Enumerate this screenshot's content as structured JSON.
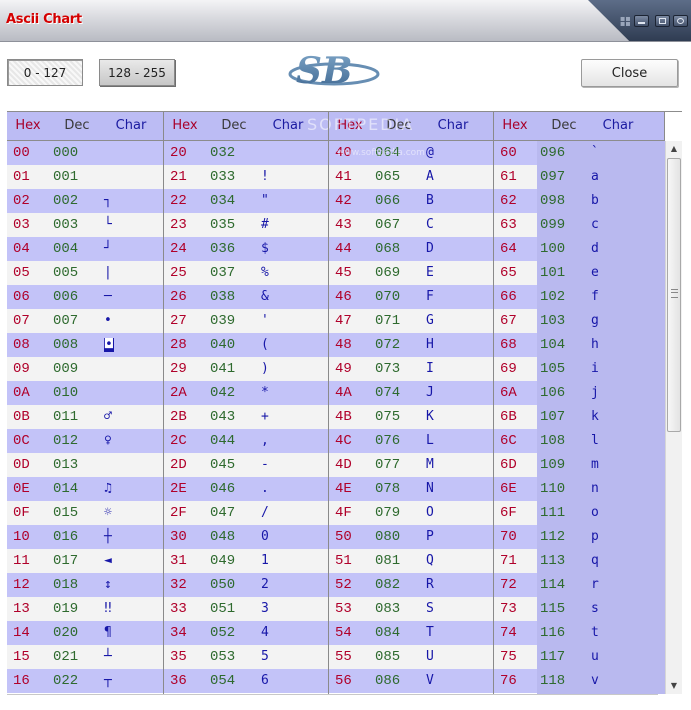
{
  "window": {
    "title": "Ascii Chart"
  },
  "toolbar": {
    "range_low_label": "0 - 127",
    "range_high_label": "128 - 255",
    "close_label": "Close",
    "logo_text": "SB"
  },
  "watermark": {
    "main": "SOFTPEDIA",
    "sub": "www.softpedia.com"
  },
  "table": {
    "groups": [
      {
        "hex": "Hex",
        "dec": "Dec",
        "char": "Char"
      },
      {
        "hex": "Hex",
        "dec": "Dec",
        "char": "Char"
      },
      {
        "hex": "Hex",
        "dec": "Dec",
        "char": "Char"
      },
      {
        "hex": "Hex",
        "dec": "Dec",
        "char": "Char"
      }
    ],
    "rows": [
      [
        [
          "00",
          "000",
          ""
        ],
        [
          "20",
          "032",
          ""
        ],
        [
          "40",
          "064",
          "@"
        ],
        [
          "60",
          "096",
          "`"
        ]
      ],
      [
        [
          "01",
          "001",
          ""
        ],
        [
          "21",
          "033",
          "!"
        ],
        [
          "41",
          "065",
          "A"
        ],
        [
          "61",
          "097",
          "a"
        ]
      ],
      [
        [
          "02",
          "002",
          "┐"
        ],
        [
          "22",
          "034",
          "\""
        ],
        [
          "42",
          "066",
          "B"
        ],
        [
          "62",
          "098",
          "b"
        ]
      ],
      [
        [
          "03",
          "003",
          "└"
        ],
        [
          "23",
          "035",
          "#"
        ],
        [
          "43",
          "067",
          "C"
        ],
        [
          "63",
          "099",
          "c"
        ]
      ],
      [
        [
          "04",
          "004",
          "┘"
        ],
        [
          "24",
          "036",
          "$"
        ],
        [
          "44",
          "068",
          "D"
        ],
        [
          "64",
          "100",
          "d"
        ]
      ],
      [
        [
          "05",
          "005",
          "|"
        ],
        [
          "25",
          "037",
          "%"
        ],
        [
          "45",
          "069",
          "E"
        ],
        [
          "65",
          "101",
          "e"
        ]
      ],
      [
        [
          "06",
          "006",
          "─"
        ],
        [
          "26",
          "038",
          "&"
        ],
        [
          "46",
          "070",
          "F"
        ],
        [
          "66",
          "102",
          "f"
        ]
      ],
      [
        [
          "07",
          "007",
          "•"
        ],
        [
          "27",
          "039",
          "'"
        ],
        [
          "47",
          "071",
          "G"
        ],
        [
          "67",
          "103",
          "g"
        ]
      ],
      [
        [
          "08",
          "008",
          "◘"
        ],
        [
          "28",
          "040",
          "("
        ],
        [
          "48",
          "072",
          "H"
        ],
        [
          "68",
          "104",
          "h"
        ]
      ],
      [
        [
          "09",
          "009",
          ""
        ],
        [
          "29",
          "041",
          ")"
        ],
        [
          "49",
          "073",
          "I"
        ],
        [
          "69",
          "105",
          "i"
        ]
      ],
      [
        [
          "0A",
          "010",
          ""
        ],
        [
          "2A",
          "042",
          "*"
        ],
        [
          "4A",
          "074",
          "J"
        ],
        [
          "6A",
          "106",
          "j"
        ]
      ],
      [
        [
          "0B",
          "011",
          "♂"
        ],
        [
          "2B",
          "043",
          "+"
        ],
        [
          "4B",
          "075",
          "K"
        ],
        [
          "6B",
          "107",
          "k"
        ]
      ],
      [
        [
          "0C",
          "012",
          "♀"
        ],
        [
          "2C",
          "044",
          ","
        ],
        [
          "4C",
          "076",
          "L"
        ],
        [
          "6C",
          "108",
          "l"
        ]
      ],
      [
        [
          "0D",
          "013",
          ""
        ],
        [
          "2D",
          "045",
          "-"
        ],
        [
          "4D",
          "077",
          "M"
        ],
        [
          "6D",
          "109",
          "m"
        ]
      ],
      [
        [
          "0E",
          "014",
          "♫"
        ],
        [
          "2E",
          "046",
          "."
        ],
        [
          "4E",
          "078",
          "N"
        ],
        [
          "6E",
          "110",
          "n"
        ]
      ],
      [
        [
          "0F",
          "015",
          "☼"
        ],
        [
          "2F",
          "047",
          "/"
        ],
        [
          "4F",
          "079",
          "O"
        ],
        [
          "6F",
          "111",
          "o"
        ]
      ],
      [
        [
          "10",
          "016",
          "┼"
        ],
        [
          "30",
          "048",
          "0"
        ],
        [
          "50",
          "080",
          "P"
        ],
        [
          "70",
          "112",
          "p"
        ]
      ],
      [
        [
          "11",
          "017",
          "◄"
        ],
        [
          "31",
          "049",
          "1"
        ],
        [
          "51",
          "081",
          "Q"
        ],
        [
          "71",
          "113",
          "q"
        ]
      ],
      [
        [
          "12",
          "018",
          "↕"
        ],
        [
          "32",
          "050",
          "2"
        ],
        [
          "52",
          "082",
          "R"
        ],
        [
          "72",
          "114",
          "r"
        ]
      ],
      [
        [
          "13",
          "019",
          "‼"
        ],
        [
          "33",
          "051",
          "3"
        ],
        [
          "53",
          "083",
          "S"
        ],
        [
          "73",
          "115",
          "s"
        ]
      ],
      [
        [
          "14",
          "020",
          "¶"
        ],
        [
          "34",
          "052",
          "4"
        ],
        [
          "54",
          "084",
          "T"
        ],
        [
          "74",
          "116",
          "t"
        ]
      ],
      [
        [
          "15",
          "021",
          "┴"
        ],
        [
          "35",
          "053",
          "5"
        ],
        [
          "55",
          "085",
          "U"
        ],
        [
          "75",
          "117",
          "u"
        ]
      ],
      [
        [
          "16",
          "022",
          "┬"
        ],
        [
          "36",
          "054",
          "6"
        ],
        [
          "56",
          "086",
          "V"
        ],
        [
          "76",
          "118",
          "v"
        ]
      ]
    ],
    "inverted_cells": [
      "08"
    ]
  },
  "icons": {
    "minimize": "minimize-icon",
    "maximize": "maximize-icon",
    "close": "close-icon",
    "scroll_up": "arrow-up-icon",
    "scroll_down": "arrow-down-icon"
  },
  "colors": {
    "title": "#d40000",
    "hex_text": "#b0002a",
    "dec_text": "#2e6a2e",
    "char_text": "#1717a8",
    "row_odd": "#c3c3f8",
    "row_even": "#f3f3f3",
    "header_bg": "#bcbcf4"
  }
}
